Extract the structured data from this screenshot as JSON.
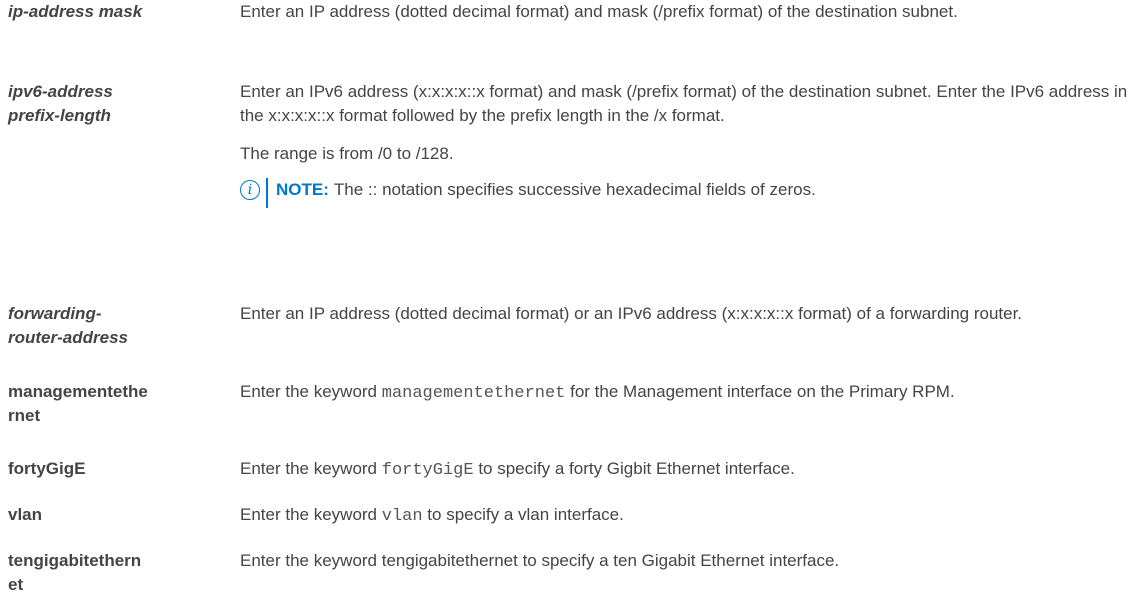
{
  "rows": [
    {
      "term": "ip-address mask",
      "desc": "Enter an IP address (dotted decimal format) and mask (/prefix format) of the destination subnet."
    },
    {
      "term_line1": "ipv6-address",
      "term_line2": "prefix-length",
      "desc": "Enter an IPv6 address (x:x:x:x::x format) and mask (/prefix format) of the destination subnet. Enter the IPv6 address in the x:x:x:x::x format followed by the prefix length in the /x format.",
      "range": "The range is from /0 to /128.",
      "note_label": "NOTE:",
      "note_text": "The :: notation specifies successive hexadecimal fields of zeros.",
      "note_icon": "info-icon"
    },
    {
      "term_line1": "forwarding-",
      "term_line2": "router-address",
      "desc": "Enter an IP address (dotted decimal format) or an IPv6 address (x:x:x:x::x format) of a forwarding router."
    },
    {
      "term_line1": "managementethe",
      "term_line2": "rnet",
      "desc_pre": "Enter the keyword",
      "keyword": "managementethernet",
      "desc_post": "for the Management interface on the Primary RPM."
    },
    {
      "term": "fortyGigE",
      "desc_pre": "Enter the keyword",
      "keyword": "fortyGigE",
      "desc_post": "to specify a forty Gigbit Ethernet interface."
    },
    {
      "term": "vlan",
      "desc_pre": "Enter the keyword",
      "keyword": "vlan",
      "desc_post": "to specify a vlan interface."
    },
    {
      "term_line1": "tengigabitethern",
      "term_line2": "et",
      "desc": "Enter the keyword tengigabitethernet to specify a ten Gigabit Ethernet interface."
    }
  ],
  "colors": {
    "text": "#444444",
    "accent": "#0076ce"
  }
}
